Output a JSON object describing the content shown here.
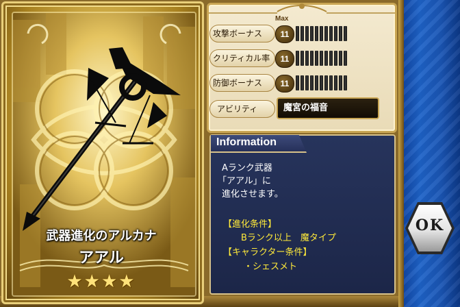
{
  "card": {
    "weapon_type": "武器進化のアルカナ",
    "weapon_name": "アアル",
    "stars": "★★★★",
    "icon": "scales-staff-icon"
  },
  "stats": {
    "max_label": "Max",
    "rows": [
      {
        "label": "攻撃ボーナス",
        "value": "11"
      },
      {
        "label": "クリティカル率",
        "value": "11"
      },
      {
        "label": "防御ボーナス",
        "value": "11"
      }
    ],
    "ability_label": "アビリティ",
    "ability_value": "魔宮の福音"
  },
  "info": {
    "title": "Information",
    "lines": [
      "Aランク武器",
      "「アアル」に",
      "進化させます。",
      "【進化条件】",
      "Bランク以上　魔タイプ",
      "【キャラクター条件】",
      "・シェスメト"
    ]
  },
  "ok_button": {
    "label": "OK"
  },
  "colors": {
    "gold": "#c9a654",
    "info_bg": "#27345c",
    "condition_yellow": "#ffea3a",
    "side_blue": "#1e63c8"
  }
}
